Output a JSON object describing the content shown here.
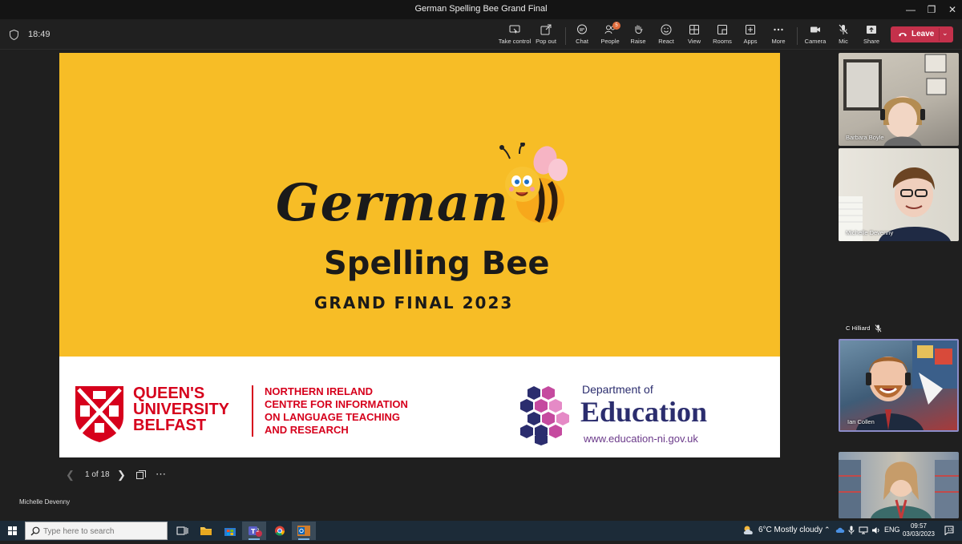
{
  "window": {
    "title": "German Spelling Bee Grand Final"
  },
  "toolbar": {
    "timer": "18:49",
    "buttons": [
      {
        "label": "Take control",
        "icon": "take-control-icon"
      },
      {
        "label": "Pop out",
        "icon": "pop-out-icon"
      },
      {
        "label": "Chat",
        "icon": "chat-icon"
      },
      {
        "label": "People",
        "icon": "people-icon",
        "badge": "5"
      },
      {
        "label": "Raise",
        "icon": "raise-hand-icon"
      },
      {
        "label": "React",
        "icon": "react-icon"
      },
      {
        "label": "View",
        "icon": "view-icon"
      },
      {
        "label": "Rooms",
        "icon": "rooms-icon"
      },
      {
        "label": "Apps",
        "icon": "apps-icon"
      },
      {
        "label": "More",
        "icon": "more-icon"
      },
      {
        "label": "Camera",
        "icon": "camera-icon"
      },
      {
        "label": "Mic",
        "icon": "mic-off-icon"
      },
      {
        "label": "Share",
        "icon": "share-icon"
      }
    ],
    "leave_label": "Leave"
  },
  "slide": {
    "line1": "German",
    "line2": "Spelling Bee",
    "line3": "GRAND FINAL 2023",
    "qub": {
      "line1": "QUEEN'S",
      "line2": "UNIVERSITY",
      "line3": "BELFAST",
      "crest_year": "ESTD 1845"
    },
    "nicilt": {
      "line1": "NORTHERN IRELAND",
      "line2": "CENTRE FOR INFORMATION",
      "line3": "ON LANGUAGE TEACHING",
      "line4": "AND RESEARCH"
    },
    "doe": {
      "line1": "Department of",
      "line2": "Education",
      "url": "www.education-ni.gov.uk"
    },
    "colors": {
      "background": "#f7bd26",
      "qub_red": "#d6001c",
      "doe_navy": "#2b2d6e"
    }
  },
  "slide_nav": {
    "counter": "1 of 18"
  },
  "presenter": "Michelle Devenny",
  "participants": [
    {
      "name": "Barbara Boyle",
      "muted": false
    },
    {
      "name": "Michelle Devenny",
      "muted": false
    },
    {
      "name": "C Hilliard",
      "muted": true
    },
    {
      "name": "Ian Collen",
      "muted": false,
      "speaking": true
    },
    {
      "name": "",
      "muted": false
    }
  ],
  "taskbar": {
    "search_placeholder": "Type here to search",
    "teams_badge": "2",
    "weather": "6°C  Mostly cloudy",
    "lang": "ENG",
    "time": "09:57",
    "date": "03/03/2023",
    "notifications": "13"
  }
}
